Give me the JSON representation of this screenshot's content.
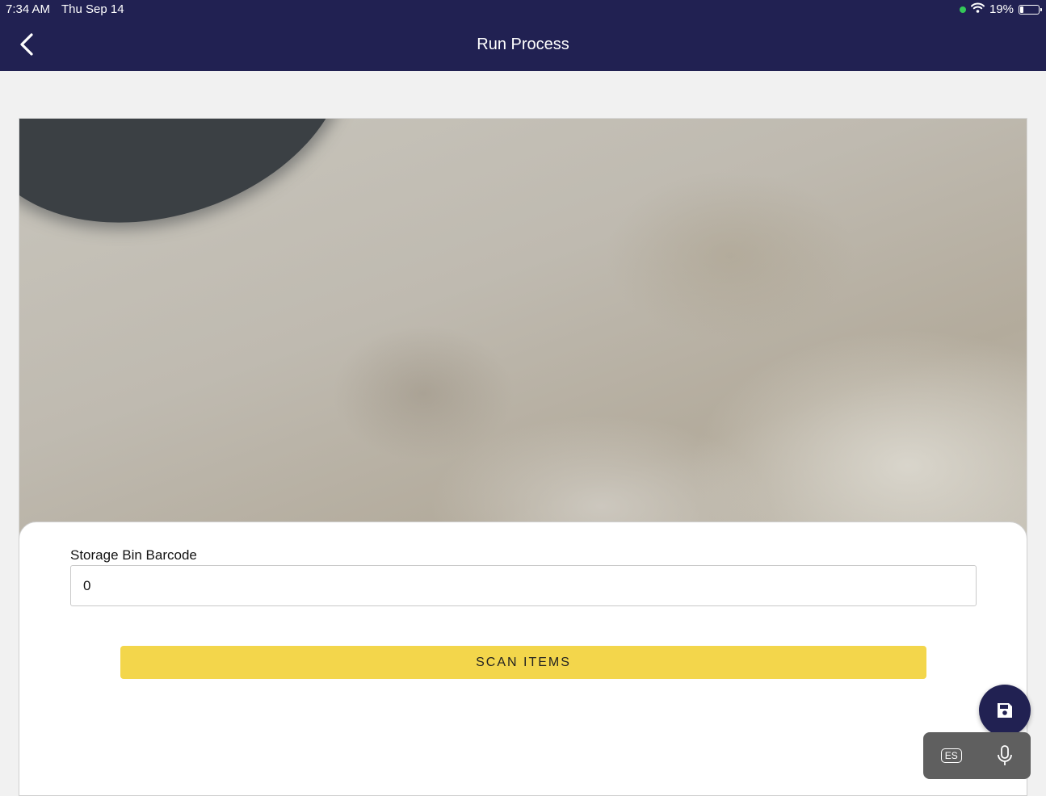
{
  "status_bar": {
    "time": "7:34 AM",
    "date": "Thu Sep 14",
    "battery": "19%",
    "battery_level": 0.19
  },
  "header": {
    "title": "Run Process",
    "back_icon": "chevron-left-icon"
  },
  "form": {
    "storage_bin_label": "Storage Bin Barcode",
    "storage_bin_value": "0",
    "scan_button_label": "SCAN ITEMS"
  },
  "fab": {
    "icon": "save-icon"
  },
  "voice_bar": {
    "language_key": "ES",
    "mic_icon": "microphone-icon"
  },
  "colors": {
    "header_bg": "#212152",
    "accent_button": "#f3d64b",
    "fab_bg": "#212152"
  }
}
